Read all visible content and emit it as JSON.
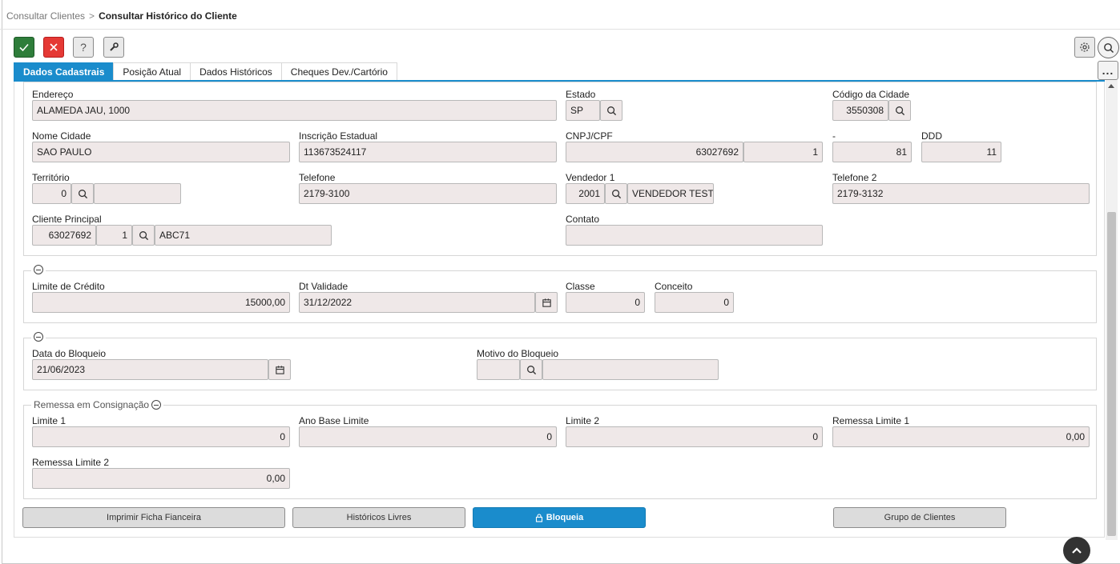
{
  "breadcrumb": {
    "parent": "Consultar Clientes",
    "separator": ">",
    "current": "Consultar Histórico do Cliente"
  },
  "toolbar": {
    "confirm_icon": "check-icon",
    "cancel_icon": "close-icon",
    "help_label": "?",
    "tools_icon": "wrench-icon",
    "settings_icon": "gear-icon",
    "search_icon": "search-icon",
    "more_label": "..."
  },
  "tabs": [
    "Dados Cadastrais",
    "Posição Atual",
    "Dados Históricos",
    "Cheques Dev./Cartório"
  ],
  "cadastro": {
    "endereco_label": "Endereço",
    "endereco": "ALAMEDA JAU, 1000",
    "estado_label": "Estado",
    "estado": "SP",
    "codigo_cidade_label": "Código da Cidade",
    "codigo_cidade": "3550308",
    "nome_cidade_label": "Nome Cidade",
    "nome_cidade": "SAO PAULO",
    "inscricao_label": "Inscrição Estadual",
    "inscricao": "113673524117",
    "cnpj_label": "CNPJ/CPF",
    "cnpj": "63027692",
    "cnpj_seq": "1",
    "dash_label": "-",
    "dash_value": "81",
    "ddd_label": "DDD",
    "ddd": "11",
    "territorio_label": "Território",
    "territorio": "0",
    "territorio_desc": "",
    "telefone_label": "Telefone",
    "telefone": "2179-3100",
    "vendedor_label": "Vendedor 1",
    "vendedor_code": "2001",
    "vendedor_name": "VENDEDOR TESTE",
    "telefone2_label": "Telefone 2",
    "telefone2": "2179-3132",
    "cliente_principal_label": "Cliente Principal",
    "cliente_principal_code": "63027692",
    "cliente_principal_seq": "1",
    "cliente_principal_name": "ABC71",
    "contato_label": "Contato",
    "contato": ""
  },
  "credito": {
    "limite_label": "Limite de Crédito",
    "limite": "15000,00",
    "validade_label": "Dt Validade",
    "validade": "31/12/2022",
    "classe_label": "Classe",
    "classe": "0",
    "conceito_label": "Conceito",
    "conceito": "0"
  },
  "bloqueio": {
    "data_label": "Data do Bloqueio",
    "data": "21/06/2023",
    "motivo_label": "Motivo do Bloqueio",
    "motivo_code": "",
    "motivo_desc": ""
  },
  "remessa": {
    "title": "Remessa em Consignação",
    "limite1_label": "Limite 1",
    "limite1": "0",
    "ano_base_label": "Ano Base Limite",
    "ano_base": "0",
    "limite2_label": "Limite 2",
    "limite2": "0",
    "remessa_limite1_label": "Remessa Limite 1",
    "remessa_limite1": "0,00",
    "remessa_limite2_label": "Remessa Limite 2",
    "remessa_limite2": "0,00"
  },
  "actions": {
    "imprimir": "Imprimir Ficha Fianceira",
    "historicos": "Históricos Livres",
    "bloqueia": "Bloqueia",
    "grupo": "Grupo de Clientes"
  },
  "colors": {
    "accent": "#1a8ccc",
    "confirm": "#2e7d3a",
    "cancel": "#e53935",
    "field_bg": "#efe8e8"
  }
}
